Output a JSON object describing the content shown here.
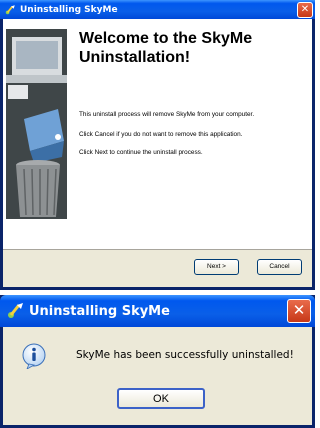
{
  "installer_window": {
    "title": "Uninstalling SkyMe",
    "heading": "Welcome to the SkyMe Uninstallation!",
    "paragraphs": [
      "This uninstall process will remove SkyMe from your computer.",
      "Click Cancel if you do not want to remove this application.",
      "Click Next to continue the uninstall process."
    ],
    "buttons": {
      "next": "Next >",
      "cancel": "Cancel"
    },
    "close_label": "✕"
  },
  "message_dialog": {
    "title": "Uninstalling SkyMe",
    "message": "SkyMe has been successfully uninstalled!",
    "ok_label": "OK",
    "close_label": "✕",
    "icon": "info-icon"
  },
  "colors": {
    "title_bar": "#0058ee",
    "dialog_face": "#ece9d8",
    "close_button": "#d9461f",
    "banner_bg": "#3f4648"
  }
}
